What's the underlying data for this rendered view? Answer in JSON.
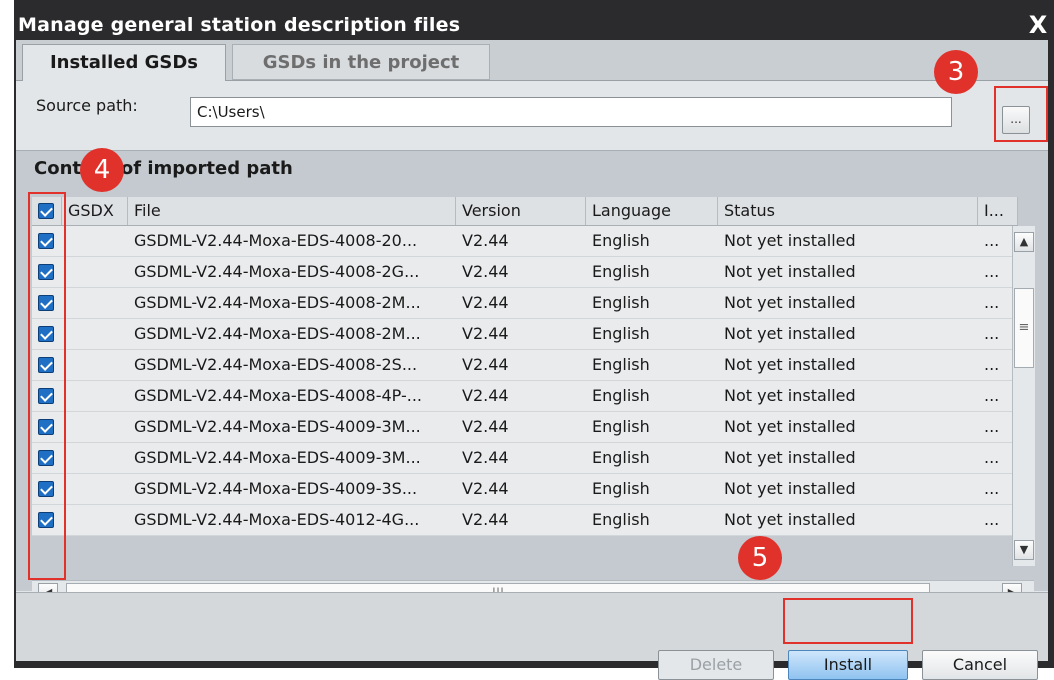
{
  "dialog": {
    "title": "Manage general station description files",
    "close_label": "X"
  },
  "tabs": [
    {
      "label": "Installed GSDs",
      "active": true
    },
    {
      "label": "GSDs in the project",
      "active": false
    }
  ],
  "source": {
    "label": "Source path:",
    "value": "C:\\Users\\",
    "browse_label": "..."
  },
  "content": {
    "title": "Content of imported path"
  },
  "table": {
    "columns": [
      "GSDX",
      "File",
      "Version",
      "Language",
      "Status",
      "I..."
    ],
    "header_checked": true,
    "rows": [
      {
        "checked": true,
        "gsdx": "",
        "file": "GSDML-V2.44-Moxa-EDS-4008-20...",
        "version": "V2.44",
        "language": "English",
        "status": "Not yet installed",
        "info": "..."
      },
      {
        "checked": true,
        "gsdx": "",
        "file": "GSDML-V2.44-Moxa-EDS-4008-2G...",
        "version": "V2.44",
        "language": "English",
        "status": "Not yet installed",
        "info": "..."
      },
      {
        "checked": true,
        "gsdx": "",
        "file": "GSDML-V2.44-Moxa-EDS-4008-2M...",
        "version": "V2.44",
        "language": "English",
        "status": "Not yet installed",
        "info": "..."
      },
      {
        "checked": true,
        "gsdx": "",
        "file": "GSDML-V2.44-Moxa-EDS-4008-2M...",
        "version": "V2.44",
        "language": "English",
        "status": "Not yet installed",
        "info": "..."
      },
      {
        "checked": true,
        "gsdx": "",
        "file": "GSDML-V2.44-Moxa-EDS-4008-2S...",
        "version": "V2.44",
        "language": "English",
        "status": "Not yet installed",
        "info": "..."
      },
      {
        "checked": true,
        "gsdx": "",
        "file": "GSDML-V2.44-Moxa-EDS-4008-4P-...",
        "version": "V2.44",
        "language": "English",
        "status": "Not yet installed",
        "info": "..."
      },
      {
        "checked": true,
        "gsdx": "",
        "file": "GSDML-V2.44-Moxa-EDS-4009-3M...",
        "version": "V2.44",
        "language": "English",
        "status": "Not yet installed",
        "info": "..."
      },
      {
        "checked": true,
        "gsdx": "",
        "file": "GSDML-V2.44-Moxa-EDS-4009-3M...",
        "version": "V2.44",
        "language": "English",
        "status": "Not yet installed",
        "info": "..."
      },
      {
        "checked": true,
        "gsdx": "",
        "file": "GSDML-V2.44-Moxa-EDS-4009-3S...",
        "version": "V2.44",
        "language": "English",
        "status": "Not yet installed",
        "info": "..."
      },
      {
        "checked": true,
        "gsdx": "",
        "file": "GSDML-V2.44-Moxa-EDS-4012-4G...",
        "version": "V2.44",
        "language": "English",
        "status": "Not yet installed",
        "info": "..."
      }
    ]
  },
  "buttons": {
    "delete": "Delete",
    "install": "Install",
    "cancel": "Cancel"
  },
  "annotations": [
    {
      "label": "3"
    },
    {
      "label": "4"
    },
    {
      "label": "5"
    }
  ],
  "colors": {
    "highlight": "#e0322b",
    "checkbox": "#1f6fc4",
    "title_bar": "#2b2b2d"
  }
}
